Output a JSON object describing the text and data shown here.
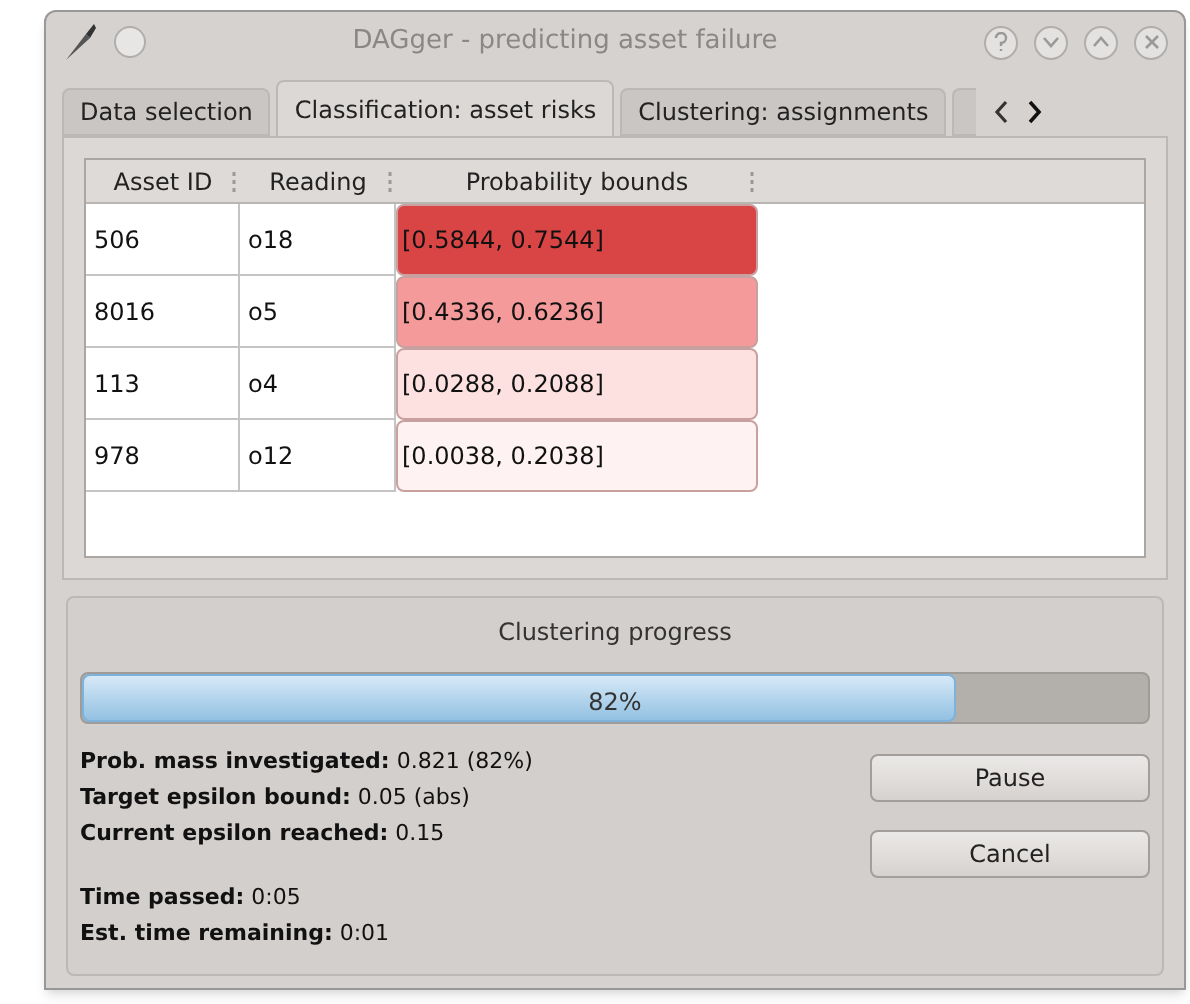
{
  "window": {
    "title": "DAGger - predicting asset failure"
  },
  "tabs": [
    {
      "label": "Data selection",
      "selected": false
    },
    {
      "label": "Classification: asset risks",
      "selected": true
    },
    {
      "label": "Clustering: assignments",
      "selected": false
    }
  ],
  "table": {
    "columns": [
      "Asset ID",
      "Reading",
      "Probability bounds"
    ],
    "rows": [
      {
        "cells": [
          "506",
          "o18",
          "[0.5844, 0.7544]"
        ],
        "color": "#d94545"
      },
      {
        "cells": [
          "8016",
          "o5",
          "[0.4336, 0.6236]"
        ],
        "color": "#f59a9a"
      },
      {
        "cells": [
          "113",
          "o4",
          "[0.0288, 0.2088]"
        ],
        "color": "#fde0e0"
      },
      {
        "cells": [
          "978",
          "o12",
          "[0.0038, 0.2038]"
        ],
        "color": "#fff2f2"
      }
    ]
  },
  "progress": {
    "title": "Clustering progress",
    "level": 0.82,
    "reading": "82%",
    "stats": [
      "**Prob. mass investigated:** 0.821 (82%)",
      "**Target epsilon bound:** 0.05 (abs)",
      "**Current epsilon reached:** 0.15"
    ],
    "times": [
      "**Time passed:** 0:05",
      "**Est. time remaining:** 0:01"
    ],
    "buttons": [
      "Pause",
      "Cancel"
    ]
  }
}
